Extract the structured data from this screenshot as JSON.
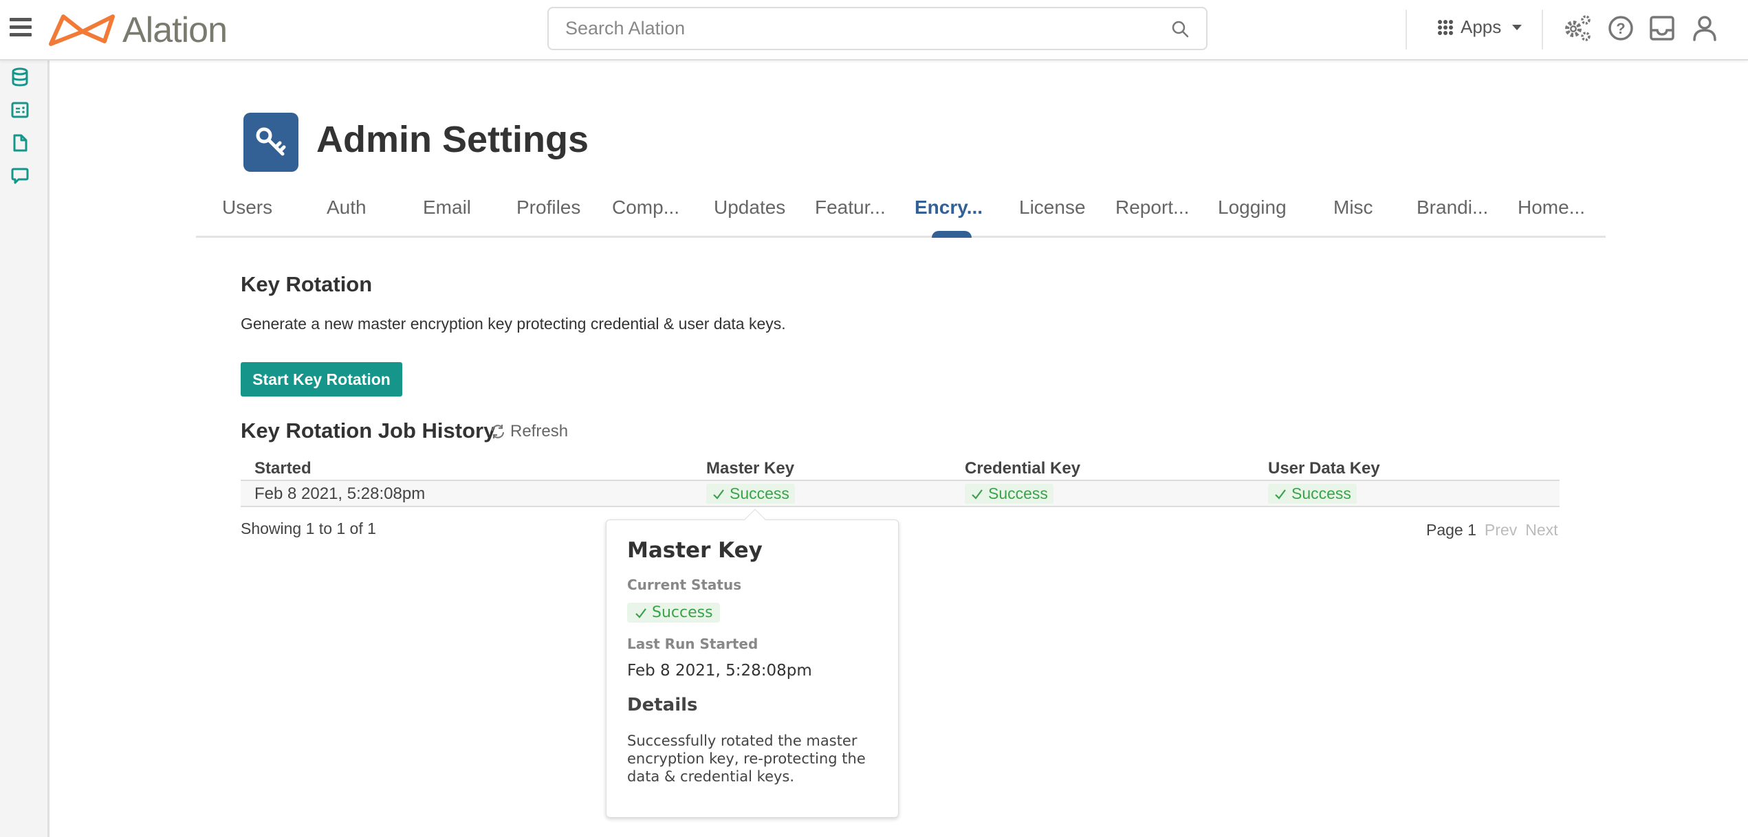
{
  "header": {
    "brand": "Alation",
    "search_placeholder": "Search Alation",
    "apps_label": "Apps",
    "colors": {
      "brand_orange": "#f27a37",
      "brand_gray": "#7a7a6e"
    }
  },
  "sidebar": {
    "items": [
      {
        "icon": "database-icon"
      },
      {
        "icon": "catalog-card-icon"
      },
      {
        "icon": "document-icon"
      },
      {
        "icon": "conversation-icon"
      }
    ],
    "icon_color": "#16968a"
  },
  "page": {
    "title": "Admin Settings",
    "title_icon": "key-icon",
    "accent": "#336195"
  },
  "tabs": [
    {
      "label": "Users",
      "active": false
    },
    {
      "label": "Auth",
      "active": false
    },
    {
      "label": "Email",
      "active": false
    },
    {
      "label": "Profiles",
      "active": false
    },
    {
      "label": "Comp...",
      "active": false
    },
    {
      "label": "Updates",
      "active": false
    },
    {
      "label": "Featur...",
      "active": false
    },
    {
      "label": "Encry...",
      "active": true
    },
    {
      "label": "License",
      "active": false
    },
    {
      "label": "Report...",
      "active": false
    },
    {
      "label": "Logging",
      "active": false
    },
    {
      "label": "Misc",
      "active": false
    },
    {
      "label": "Brandi...",
      "active": false
    },
    {
      "label": "Home...",
      "active": false
    }
  ],
  "key_rotation": {
    "heading": "Key Rotation",
    "description": "Generate a new master encryption key protecting credential & user data keys.",
    "button_label": "Start Key Rotation",
    "button_color": "#16968a"
  },
  "history": {
    "heading": "Key Rotation Job History",
    "refresh_label": "Refresh",
    "columns": [
      "Started",
      "Master Key",
      "Credential Key",
      "User Data Key"
    ],
    "rows": [
      {
        "started": "Feb 8 2021, 5:28:08pm",
        "master": "Success",
        "credential": "Success",
        "user_data": "Success"
      }
    ],
    "showing": "Showing 1 to 1 of 1",
    "pager": {
      "page": "Page 1",
      "prev": "Prev",
      "next": "Next"
    },
    "success_color": "#3aa34a"
  },
  "popover": {
    "title": "Master Key",
    "status_label": "Current Status",
    "status": "Success",
    "last_run_label": "Last Run Started",
    "last_run": "Feb 8 2021, 5:28:08pm",
    "details_heading": "Details",
    "details": "Successfully rotated the master encryption key, re-protecting the data & credential keys."
  }
}
